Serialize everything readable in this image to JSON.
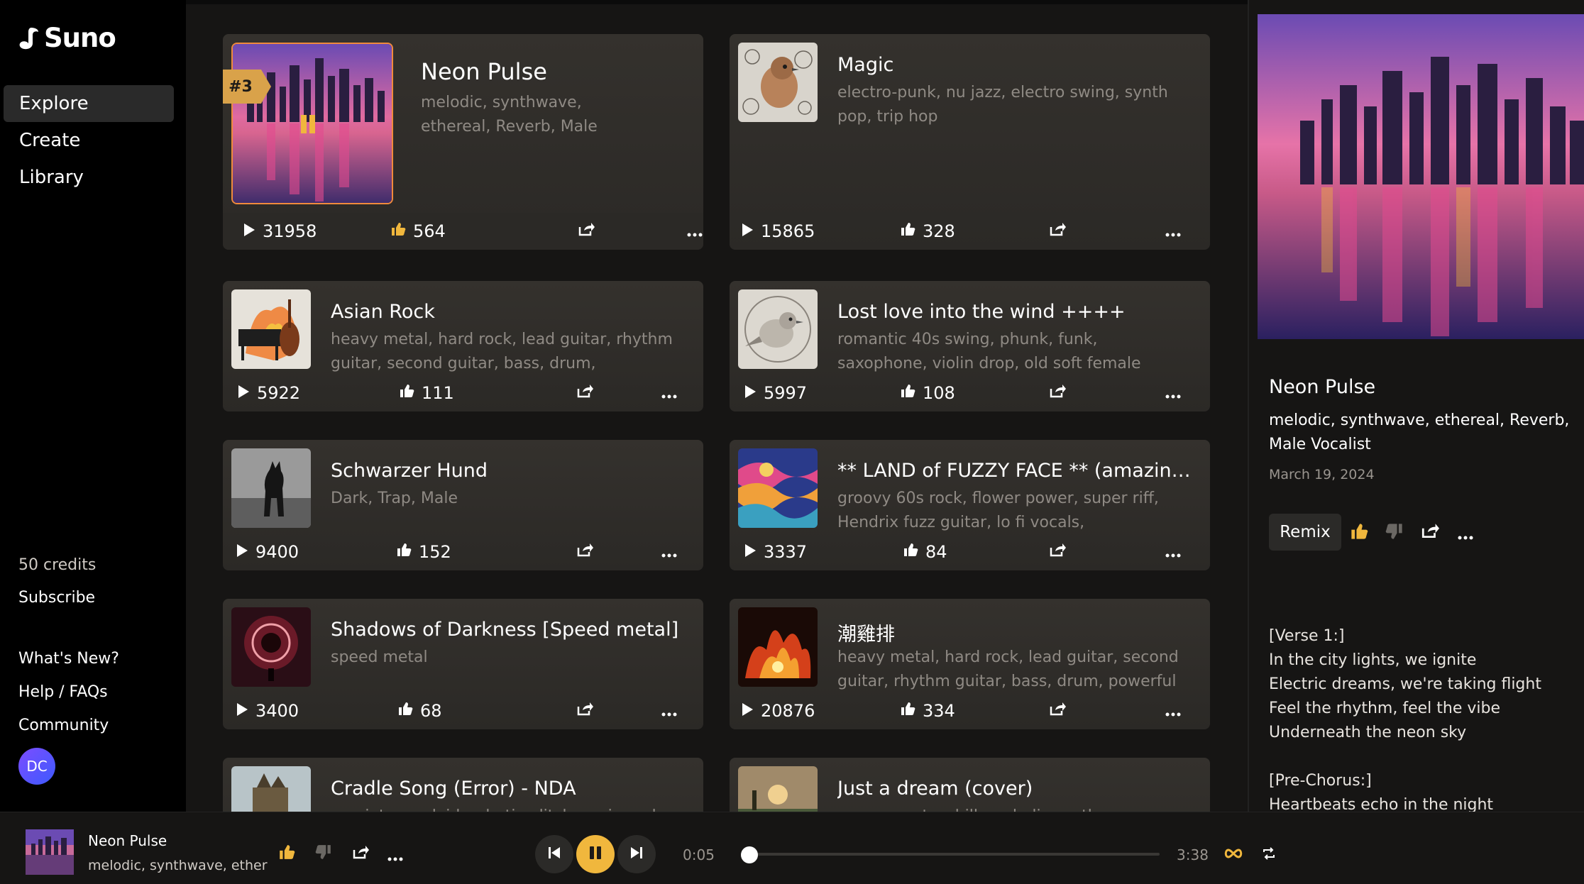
{
  "app": {
    "name": "Suno"
  },
  "sidebar": {
    "nav": [
      {
        "label": "Explore",
        "active": true
      },
      {
        "label": "Create",
        "active": false
      },
      {
        "label": "Library",
        "active": false
      }
    ],
    "credits": "50 credits",
    "subscribe": "Subscribe",
    "links": [
      "What's New?",
      "Help / FAQs",
      "Community"
    ],
    "avatar_initials": "DC"
  },
  "songs": [
    {
      "title": "Neon Pulse",
      "tags": "melodic, synthwave, ethereal, Reverb, Male Vocalist",
      "plays": "31958",
      "likes": "564",
      "rank": "#3",
      "art": "city"
    },
    {
      "title": "Magic",
      "tags": "electro-punk, nu jazz, electro swing, synth pop, trip hop",
      "plays": "15865",
      "likes": "328",
      "art": "bird"
    },
    {
      "title": "Asian Rock",
      "tags": "heavy metal, hard rock, lead guitar, rhythm guitar, second guitar, bass, drum, shamisen,...",
      "plays": "5922",
      "likes": "111",
      "art": "instruments"
    },
    {
      "title": "Lost love into the wind ++++",
      "tags": "romantic 40s swing, phunk, funk, saxophone, violin drop, old soft female vocals, experimental...",
      "plays": "5997",
      "likes": "108",
      "art": "bird"
    },
    {
      "title": "Schwarzer Hund",
      "tags": "Dark, Trap, Male",
      "plays": "9400",
      "likes": "152",
      "art": "dog"
    },
    {
      "title": "** LAND of FUZZY FACE ** (amazing...",
      "tags": "groovy 60s rock, flower power, super riff, Hendrix fuzz guitar, lo fi vocals, experimental,...",
      "plays": "3337",
      "likes": "84",
      "art": "psychedelic"
    },
    {
      "title": "Shadows of Darkness [Speed metal]",
      "tags": "speed metal",
      "plays": "3400",
      "likes": "68",
      "art": "dark"
    },
    {
      "title": "潮雞排",
      "tags": "heavy metal, hard rock, lead guitar, second guitar, rhythm guitar, bass, drum, powerful man...",
      "plays": "20876",
      "likes": "334",
      "art": "fire"
    },
    {
      "title": "Cradle Song (Error) - NDA",
      "tags": "a quiet, vocaloid, robotic glitch, eerie and",
      "plays": "",
      "likes": "",
      "art": "castle"
    },
    {
      "title": "Just a dream (cover)",
      "tags": "reggae roots, chill, melodic synthwave",
      "plays": "",
      "likes": "",
      "art": "landscape"
    }
  ],
  "detail": {
    "title": "Neon Pulse",
    "tags": "melodic, synthwave, ethereal, Reverb, Male Vocalist",
    "date": "March 19, 2024",
    "remix_label": "Remix",
    "lyrics": [
      "[Verse 1:]",
      "In the city lights, we ignite",
      "Electric dreams, we're taking flight",
      "Feel the rhythm, feel the vibe",
      "Underneath the neon sky",
      "",
      "[Pre-Chorus:]",
      "Heartbeats echo in the night"
    ]
  },
  "player": {
    "title": "Neon Pulse",
    "tags": "melodic, synthwave, ether",
    "elapsed": "0:05",
    "duration": "3:38",
    "progress": 0.02
  },
  "colors": {
    "accent": "#f0b73d",
    "rank_badge": "#d9a24a",
    "card": "#302e2a",
    "background": "#161514"
  }
}
